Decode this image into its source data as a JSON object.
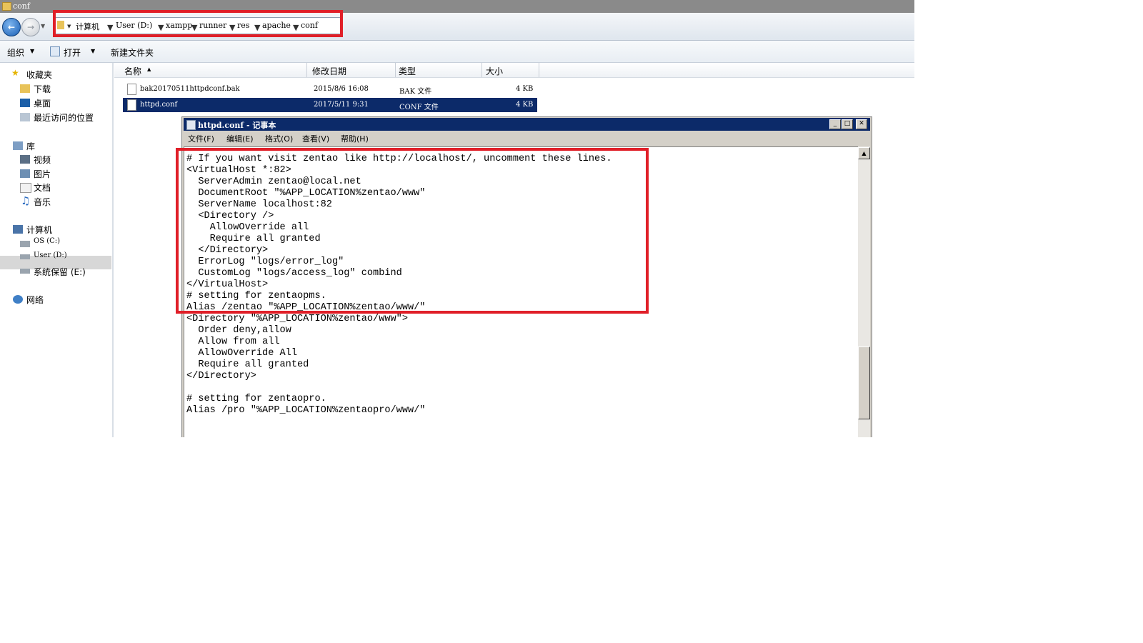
{
  "window": {
    "title": "conf"
  },
  "address_bar": {
    "crumbs": [
      "计算机",
      "User (D:)",
      "xampp",
      "runner",
      "res",
      "apache",
      "conf"
    ]
  },
  "toolbar": {
    "organize": "组织",
    "open": "打开",
    "new_folder": "新建文件夹"
  },
  "sidebar": {
    "favorites": "收藏夹",
    "downloads": "下载",
    "desktop": "桌面",
    "recent": "最近访问的位置",
    "libraries": "库",
    "videos": "视频",
    "pictures": "图片",
    "documents": "文档",
    "music": "音乐",
    "computer": "计算机",
    "drive_c": "OS (C:)",
    "drive_d": "User (D:)",
    "drive_e": "系统保留 (E:)",
    "network": "网络"
  },
  "columns": {
    "name": "名称",
    "date": "修改日期",
    "type": "类型",
    "size": "大小"
  },
  "files": [
    {
      "name": "bak20170511httpdconf.bak",
      "date": "2015/8/6 16:08",
      "type": "BAK 文件",
      "size": "4 KB"
    },
    {
      "name": "httpd.conf",
      "date": "2017/5/11 9:31",
      "type": "CONF 文件",
      "size": "4 KB"
    }
  ],
  "notepad": {
    "title": "httpd.conf - 记事本",
    "menu": [
      "文件(F)",
      "编辑(E)",
      "格式(O)",
      "查看(V)",
      "帮助(H)"
    ],
    "text": "# If you want visit zentao like http://localhost/, uncomment these lines.\n<VirtualHost *:82>\n  ServerAdmin zentao@local.net\n  DocumentRoot \"%APP_LOCATION%zentao/www\"\n  ServerName localhost:82\n  <Directory />\n    AllowOverride all\n    Require all granted\n  </Directory>\n  ErrorLog \"logs/error_log\"\n  CustomLog \"logs/access_log\" combind\n</VirtualHost>\n# setting for zentaopms.\nAlias /zentao \"%APP_LOCATION%zentao/www/\"\n<Directory \"%APP_LOCATION%zentao/www\">\n  Order deny,allow\n  Allow from all\n  AllowOverride All\n  Require all granted\n</Directory>\n\n# setting for zentaopro.\nAlias /pro \"%APP_LOCATION%zentaopro/www/\""
  },
  "colors": {
    "highlight_red": "#e01f28",
    "selection_blue": "#0c2a69"
  }
}
